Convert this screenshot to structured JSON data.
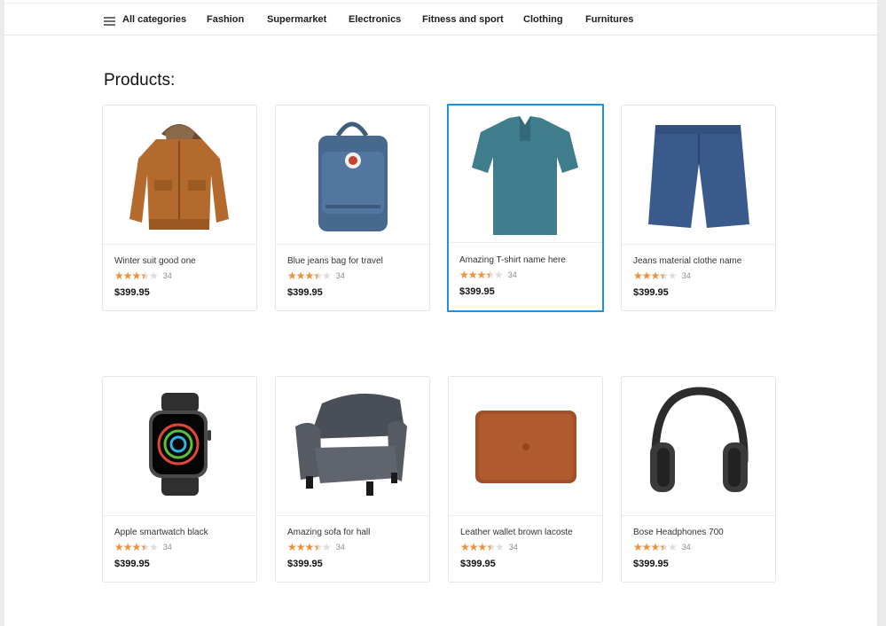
{
  "nav": {
    "all_categories": "All categories",
    "items": [
      "Fashion",
      "Supermarket",
      "Electronics",
      "Fitness and sport",
      "Clothing",
      "Furnitures"
    ]
  },
  "page_title": "Products:",
  "colors": {
    "star": "#f1913a",
    "selected_border": "#1e90e6"
  },
  "products": [
    {
      "name": "Winter suit good one",
      "rating": 3.5,
      "count": "34",
      "price": "$399.95",
      "icon": "jacket"
    },
    {
      "name": "Blue jeans bag for travel",
      "rating": 3.5,
      "count": "34",
      "price": "$399.95",
      "icon": "backpack"
    },
    {
      "name": "Amazing T-shirt name here",
      "rating": 3.5,
      "count": "34",
      "price": "$399.95",
      "icon": "polo-shirt",
      "selected": true
    },
    {
      "name": "Jeans material clothe name",
      "rating": 3.5,
      "count": "34",
      "price": "$399.95",
      "icon": "denim-shorts"
    },
    {
      "name": "Apple smartwatch black",
      "rating": 3.5,
      "count": "34",
      "price": "$399.95",
      "icon": "smartwatch"
    },
    {
      "name": "Amazing sofa for hall",
      "rating": 3.5,
      "count": "34",
      "price": "$399.95",
      "icon": "armchair"
    },
    {
      "name": "Leather wallet brown lacoste",
      "rating": 3.5,
      "count": "34",
      "price": "$399.95",
      "icon": "leather-sleeve"
    },
    {
      "name": "Bose Headphones 700",
      "rating": 3.5,
      "count": "34",
      "price": "$399.95",
      "icon": "headphones"
    }
  ]
}
